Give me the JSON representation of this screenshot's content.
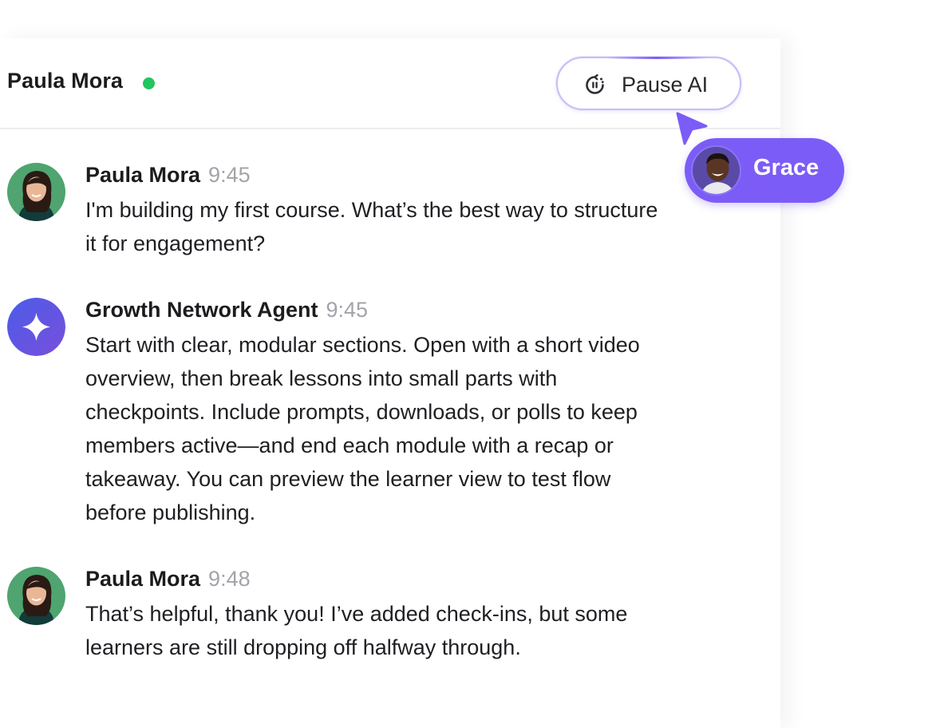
{
  "header": {
    "contact_name": "Paula Mora",
    "status": "online",
    "pause_button_label": "Pause AI"
  },
  "collaborator": {
    "name": "Grace",
    "color": "#7c5cf6"
  },
  "messages": [
    {
      "sender": "Paula Mora",
      "time": "9:45",
      "avatar": "paula-photo",
      "lines": [
        "I'm building my first course. What’s the best way to structure",
        "it for engagement?"
      ]
    },
    {
      "sender": "Growth Network Agent",
      "time": "9:45",
      "avatar": "sparkle-icon",
      "lines": [
        "Start with clear, modular sections. Open with a short video",
        "overview, then break lessons into small parts with",
        "checkpoints. Include prompts, downloads, or polls to keep",
        "members active—and end each module with a recap or",
        "takeaway. You can preview the learner view to test flow",
        "before publishing."
      ]
    },
    {
      "sender": "Paula Mora",
      "time": "9:48",
      "avatar": "paula-photo",
      "lines": [
        "That’s helpful, thank you! I’ve added check-ins, but some",
        "learners are still dropping off halfway through."
      ]
    }
  ],
  "colors": {
    "online_dot": "#22c55e",
    "accent": "#7c5cf6",
    "agent_avatar": "#5b52e8",
    "timestamp": "#a3a3aa"
  }
}
